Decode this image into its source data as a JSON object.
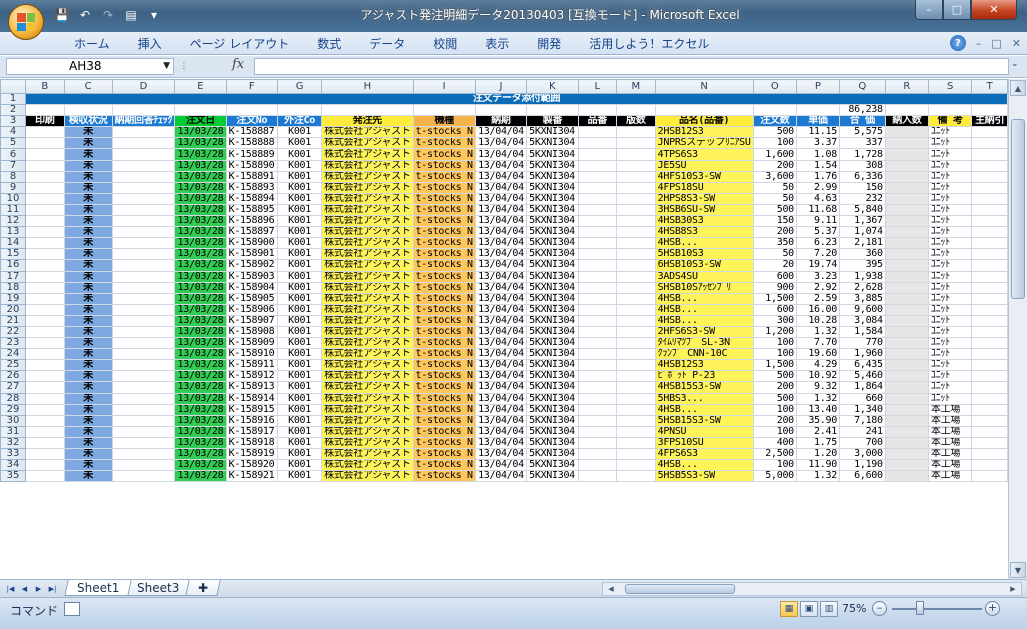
{
  "window": {
    "title": "アジャスト発注明細データ20130403 [互換モード] - Microsoft Excel",
    "controls": {
      "minimize": "–",
      "maximize": "□",
      "close": "✕"
    }
  },
  "qat": {
    "save": "💾",
    "undo": "↶",
    "redo": "↷",
    "preview": "▤",
    "customize": "▾"
  },
  "ribbon": {
    "tabs": [
      "ホーム",
      "挿入",
      "ページ レイアウト",
      "数式",
      "データ",
      "校閲",
      "表示",
      "開発",
      "活用しよう！エクセル"
    ],
    "help": "?",
    "min": "–",
    "restore": "□",
    "close": "✕"
  },
  "formula_bar": {
    "name_box": "AH38",
    "fx": "fx",
    "content": ""
  },
  "columns": [
    "B",
    "C",
    "D",
    "E",
    "F",
    "G",
    "H",
    "I",
    "J",
    "K",
    "L",
    "M",
    "N",
    "O",
    "P",
    "Q",
    "R",
    "S",
    "T"
  ],
  "sheet": {
    "title": "注文データ添付範囲",
    "total": "86,238",
    "headers": [
      "印刷",
      "検収状況",
      "納期回答ﾁｪｯｸ",
      "注文日",
      "注文No",
      "外注Co",
      "発注先",
      "機種",
      "納期",
      "製番",
      "品番",
      "版数",
      "品名(品番)",
      "注文数",
      "単価",
      "合 価",
      "納入数",
      "備 考",
      "主納引"
    ],
    "rows": [
      {
        "r": "4",
        "c": "未",
        "e": "13/03/28",
        "f": "K-158887",
        "g": "K001",
        "h": "株式会社アジャスト",
        "i": "t-stocks N",
        "j": "13/04/04",
        "k": "5KXNI304",
        "n": "2HSB12S3",
        "o": "500",
        "p": "11.15",
        "q": "5,575",
        "s": "ﾕﾆｯﾄ"
      },
      {
        "r": "5",
        "c": "未",
        "e": "13/03/28",
        "f": "K-158888",
        "g": "K001",
        "h": "株式会社アジャスト",
        "i": "t-stocks N",
        "j": "13/04/04",
        "k": "5KXNI304",
        "n": "JNPRSステップﾘﾆｱSU",
        "o": "100",
        "p": "3.37",
        "q": "337",
        "s": "ﾕﾆｯﾄ"
      },
      {
        "r": "6",
        "c": "未",
        "e": "13/03/28",
        "f": "K-158889",
        "g": "K001",
        "h": "株式会社アジャスト",
        "i": "t-stocks N",
        "j": "13/04/04",
        "k": "5KXNI304",
        "n": "4TPS6S3",
        "o": "1,600",
        "p": "1.08",
        "q": "1,728",
        "s": "ﾕﾆｯﾄ"
      },
      {
        "r": "7",
        "c": "未",
        "e": "13/03/28",
        "f": "K-158890",
        "g": "K001",
        "h": "株式会社アジャスト",
        "i": "t-stocks N",
        "j": "13/04/04",
        "k": "5KXNI304",
        "n": "JE5SU",
        "o": "200",
        "p": "1.54",
        "q": "308",
        "s": "ﾕﾆｯﾄ"
      },
      {
        "r": "8",
        "c": "未",
        "e": "13/03/28",
        "f": "K-158891",
        "g": "K001",
        "h": "株式会社アジャスト",
        "i": "t-stocks N",
        "j": "13/04/04",
        "k": "5KXNI304",
        "n": "4HFS10S3-SW",
        "o": "3,600",
        "p": "1.76",
        "q": "6,336",
        "s": "ﾕﾆｯﾄ"
      },
      {
        "r": "9",
        "c": "未",
        "e": "13/03/28",
        "f": "K-158893",
        "g": "K001",
        "h": "株式会社アジャスト",
        "i": "t-stocks N",
        "j": "13/04/04",
        "k": "5KXNI304",
        "n": "4FPS18SU",
        "o": "50",
        "p": "2.99",
        "q": "150",
        "s": "ﾕﾆｯﾄ"
      },
      {
        "r": "10",
        "c": "未",
        "e": "13/03/28",
        "f": "K-158894",
        "g": "K001",
        "h": "株式会社アジャスト",
        "i": "t-stocks N",
        "j": "13/04/04",
        "k": "5KXNI304",
        "n": "2HPS8S3-SW",
        "o": "50",
        "p": "4.63",
        "q": "232",
        "s": "ﾕﾆｯﾄ"
      },
      {
        "r": "11",
        "c": "未",
        "e": "13/03/28",
        "f": "K-158895",
        "g": "K001",
        "h": "株式会社アジャスト",
        "i": "t-stocks N",
        "j": "13/04/04",
        "k": "5KXNI304",
        "n": "3HSB6SU-SW",
        "o": "500",
        "p": "11.68",
        "q": "5,840",
        "s": "ﾕﾆｯﾄ"
      },
      {
        "r": "12",
        "c": "未",
        "e": "13/03/28",
        "f": "K-158896",
        "g": "K001",
        "h": "株式会社アジャスト",
        "i": "t-stocks N",
        "j": "13/04/04",
        "k": "5KXNI304",
        "n": "4HSB30S3",
        "o": "150",
        "p": "9.11",
        "q": "1,367",
        "s": "ﾕﾆｯﾄ"
      },
      {
        "r": "13",
        "c": "未",
        "e": "13/03/28",
        "f": "K-158897",
        "g": "K001",
        "h": "株式会社アジャスト",
        "i": "t-stocks N",
        "j": "13/04/04",
        "k": "5KXNI304",
        "n": "4HSB8S3",
        "o": "200",
        "p": "5.37",
        "q": "1,074",
        "s": "ﾕﾆｯﾄ"
      },
      {
        "r": "14",
        "c": "未",
        "e": "13/03/28",
        "f": "K-158900",
        "g": "K001",
        "h": "株式会社アジャスト",
        "i": "t-stocks N",
        "j": "13/04/04",
        "k": "5KXNI304",
        "n": "4HSB...",
        "o": "350",
        "p": "6.23",
        "q": "2,181",
        "s": "ﾕﾆｯﾄ"
      },
      {
        "r": "15",
        "c": "未",
        "e": "13/03/28",
        "f": "K-158901",
        "g": "K001",
        "h": "株式会社アジャスト",
        "i": "t-stocks N",
        "j": "13/04/04",
        "k": "5KXNI304",
        "n": "5HSB10S3",
        "o": "50",
        "p": "7.20",
        "q": "360",
        "s": "ﾕﾆｯﾄ"
      },
      {
        "r": "16",
        "c": "未",
        "e": "13/03/28",
        "f": "K-158902",
        "g": "K001",
        "h": "株式会社アジャスト",
        "i": "t-stocks N",
        "j": "13/04/04",
        "k": "5KXNI304",
        "n": "6HSB10S3-SW",
        "o": "20",
        "p": "19.74",
        "q": "395",
        "s": "ﾕﾆｯﾄ"
      },
      {
        "r": "17",
        "c": "未",
        "e": "13/03/28",
        "f": "K-158903",
        "g": "K001",
        "h": "株式会社アジャスト",
        "i": "t-stocks N",
        "j": "13/04/04",
        "k": "5KXNI304",
        "n": "3ADS4SU",
        "o": "600",
        "p": "3.23",
        "q": "1,938",
        "s": "ﾕﾆｯﾄ"
      },
      {
        "r": "18",
        "c": "未",
        "e": "13/03/28",
        "f": "K-158904",
        "g": "K001",
        "h": "株式会社アジャスト",
        "i": "t-stocks N",
        "j": "13/04/04",
        "k": "5KXNI304",
        "n": "SHSB10Sｱｯｾﾝﾌﾞﾘ",
        "o": "900",
        "p": "2.92",
        "q": "2,628",
        "s": "ﾕﾆｯﾄ"
      },
      {
        "r": "19",
        "c": "未",
        "e": "13/03/28",
        "f": "K-158905",
        "g": "K001",
        "h": "株式会社アジャスト",
        "i": "t-stocks N",
        "j": "13/04/04",
        "k": "5KXNI304",
        "n": "4HSB...",
        "o": "1,500",
        "p": "2.59",
        "q": "3,885",
        "s": "ﾕﾆｯﾄ"
      },
      {
        "r": "20",
        "c": "未",
        "e": "13/03/28",
        "f": "K-158906",
        "g": "K001",
        "h": "株式会社アジャスト",
        "i": "t-stocks N",
        "j": "13/04/04",
        "k": "5KXNI304",
        "n": "4HSB...",
        "o": "600",
        "p": "16.00",
        "q": "9,600",
        "s": "ﾕﾆｯﾄ"
      },
      {
        "r": "21",
        "c": "未",
        "e": "13/03/28",
        "f": "K-158907",
        "g": "K001",
        "h": "株式会社アジャスト",
        "i": "t-stocks N",
        "j": "13/04/04",
        "k": "5KXNI304",
        "n": "4HSB...",
        "o": "300",
        "p": "10.28",
        "q": "3,084",
        "s": "ﾕﾆｯﾄ"
      },
      {
        "r": "22",
        "c": "未",
        "e": "13/03/28",
        "f": "K-158908",
        "g": "K001",
        "h": "株式会社アジャスト",
        "i": "t-stocks N",
        "j": "13/04/04",
        "k": "5KXNI304",
        "n": "2HFS6S3-SW",
        "o": "1,200",
        "p": "1.32",
        "q": "1,584",
        "s": "ﾕﾆｯﾄ"
      },
      {
        "r": "23",
        "c": "未",
        "e": "13/03/28",
        "f": "K-158909",
        "g": "K001",
        "h": "株式会社アジャスト",
        "i": "t-stocks N",
        "j": "13/04/04",
        "k": "5KXNI304",
        "n": "ﾀｲﾑﾘﾏﾂﾌﾟ SL-3N",
        "o": "100",
        "p": "7.70",
        "q": "770",
        "s": "ﾕﾆｯﾄ"
      },
      {
        "r": "24",
        "c": "未",
        "e": "13/03/28",
        "f": "K-158910",
        "g": "K001",
        "h": "株式会社アジャスト",
        "i": "t-stocks N",
        "j": "13/04/04",
        "k": "5KXNI304",
        "n": "ｸﾗﾝﾌﾟ CNN-10C",
        "o": "100",
        "p": "19.60",
        "q": "1,960",
        "s": "ﾕﾆｯﾄ"
      },
      {
        "r": "25",
        "c": "未",
        "e": "13/03/28",
        "f": "K-158911",
        "g": "K001",
        "h": "株式会社アジャスト",
        "i": "t-stocks N",
        "j": "13/04/04",
        "k": "5KXNI304",
        "n": "4HSB12S3",
        "o": "1,500",
        "p": "4.29",
        "q": "6,435",
        "s": "ﾕﾆｯﾄ"
      },
      {
        "r": "26",
        "c": "未",
        "e": "13/03/28",
        "f": "K-158912",
        "g": "K001",
        "h": "株式会社アジャスト",
        "i": "t-stocks N",
        "j": "13/04/04",
        "k": "5KXNI304",
        "n": "ﾋﾟﾎﾞｯﾄ P-23",
        "o": "500",
        "p": "10.92",
        "q": "5,460",
        "s": "ﾕﾆｯﾄ"
      },
      {
        "r": "27",
        "c": "未",
        "e": "13/03/28",
        "f": "K-158913",
        "g": "K001",
        "h": "株式会社アジャスト",
        "i": "t-stocks N",
        "j": "13/04/04",
        "k": "5KXNI304",
        "n": "4HSB15S3-SW",
        "o": "200",
        "p": "9.32",
        "q": "1,864",
        "s": "ﾕﾆｯﾄ"
      },
      {
        "r": "28",
        "c": "未",
        "e": "13/03/28",
        "f": "K-158914",
        "g": "K001",
        "h": "株式会社アジャスト",
        "i": "t-stocks N",
        "j": "13/04/04",
        "k": "5KXNI304",
        "n": "5HBS3...",
        "o": "500",
        "p": "1.32",
        "q": "660",
        "s": "ﾕﾆｯﾄ"
      },
      {
        "r": "29",
        "c": "未",
        "e": "13/03/28",
        "f": "K-158915",
        "g": "K001",
        "h": "株式会社アジャスト",
        "i": "t-stocks N",
        "j": "13/04/04",
        "k": "5KXNI304",
        "n": "4HSB...",
        "o": "100",
        "p": "13.40",
        "q": "1,340",
        "s": "本工場"
      },
      {
        "r": "30",
        "c": "未",
        "e": "13/03/28",
        "f": "K-158916",
        "g": "K001",
        "h": "株式会社アジャスト",
        "i": "t-stocks N",
        "j": "13/04/04",
        "k": "5KXNI304",
        "n": "5HSB15S3-SW",
        "o": "200",
        "p": "35.90",
        "q": "7,180",
        "s": "本工場"
      },
      {
        "r": "31",
        "c": "未",
        "e": "13/03/28",
        "f": "K-158917",
        "g": "K001",
        "h": "株式会社アジャスト",
        "i": "t-stocks N",
        "j": "13/04/04",
        "k": "5KXNI304",
        "n": "4PNSU",
        "o": "100",
        "p": "2.41",
        "q": "241",
        "s": "本工場"
      },
      {
        "r": "32",
        "c": "未",
        "e": "13/03/28",
        "f": "K-158918",
        "g": "K001",
        "h": "株式会社アジャスト",
        "i": "t-stocks N",
        "j": "13/04/04",
        "k": "5KXNI304",
        "n": "3FPS10SU",
        "o": "400",
        "p": "1.75",
        "q": "700",
        "s": "本工場"
      },
      {
        "r": "33",
        "c": "未",
        "e": "13/03/28",
        "f": "K-158919",
        "g": "K001",
        "h": "株式会社アジャスト",
        "i": "t-stocks N",
        "j": "13/04/04",
        "k": "5KXNI304",
        "n": "4FPS6S3",
        "o": "2,500",
        "p": "1.20",
        "q": "3,000",
        "s": "本工場"
      },
      {
        "r": "34",
        "c": "未",
        "e": "13/03/28",
        "f": "K-158920",
        "g": "K001",
        "h": "株式会社アジャスト",
        "i": "t-stocks N",
        "j": "13/04/04",
        "k": "5KXNI304",
        "n": "4HSB...",
        "o": "100",
        "p": "11.90",
        "q": "1,190",
        "s": "本工場"
      },
      {
        "r": "35",
        "c": "未",
        "e": "13/03/28",
        "f": "K-158921",
        "g": "K001",
        "h": "株式会社アジャスト",
        "i": "t-stocks N",
        "j": "13/04/04",
        "k": "5KXNI304",
        "n": "5HSB5S3-SW",
        "o": "5,000",
        "p": "1.32",
        "q": "6,600",
        "s": "本工場"
      }
    ]
  },
  "sheet_tabs": [
    "Sheet1",
    "Sheet3"
  ],
  "sheet_nav": [
    "|◀",
    "◀",
    "▶",
    "▶|"
  ],
  "status": {
    "mode": "コマンド",
    "zoom": "75%",
    "zoom_out": "–",
    "zoom_in": "+"
  }
}
